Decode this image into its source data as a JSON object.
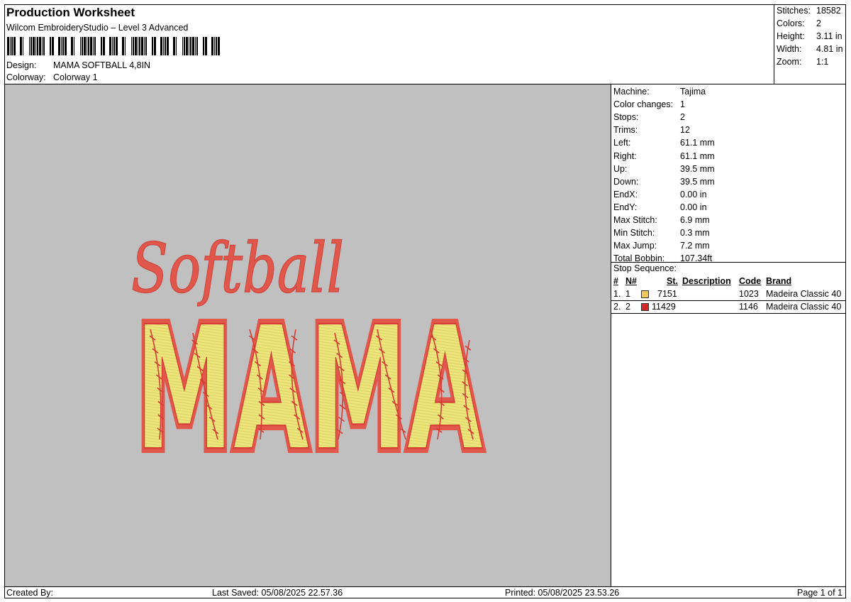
{
  "header": {
    "title": "Production Worksheet",
    "software": "Wilcom EmbroideryStudio – Level 3 Advanced",
    "design_label": "Design:",
    "design_value": "MAMA SOFTBALL 4,8IN",
    "colorway_label": "Colorway:",
    "colorway_value": "Colorway 1"
  },
  "stats": [
    {
      "label": "Stitches:",
      "value": "18582"
    },
    {
      "label": "Colors:",
      "value": "2"
    },
    {
      "label": "Height:",
      "value": "3.11 in"
    },
    {
      "label": "Width:",
      "value": "4.81 in"
    },
    {
      "label": "Zoom:",
      "value": "1:1"
    }
  ],
  "design_preview": {
    "script_text": "Softball",
    "block_text": "MAMA",
    "colors": {
      "background": "#c0c0c0",
      "outline_red": "#e2574c",
      "fill_yellow": "#ece57c",
      "seam_red": "#d43c34"
    }
  },
  "machine_info": [
    {
      "label": "Machine:",
      "value": "Tajima"
    },
    {
      "label": "Color changes:",
      "value": "1"
    },
    {
      "label": "Stops:",
      "value": "2"
    },
    {
      "label": "Trims:",
      "value": "12"
    },
    {
      "label": "Left:",
      "value": "61.1 mm"
    },
    {
      "label": "Right:",
      "value": "61.1 mm"
    },
    {
      "label": "Up:",
      "value": "39.5 mm"
    },
    {
      "label": "Down:",
      "value": "39.5 mm"
    },
    {
      "label": "EndX:",
      "value": "0.00 in"
    },
    {
      "label": "EndY:",
      "value": "0.00 in"
    },
    {
      "label": "Max Stitch:",
      "value": "6.9 mm"
    },
    {
      "label": "Min Stitch:",
      "value": "0.3 mm"
    },
    {
      "label": "Max Jump:",
      "value": "7.2 mm"
    },
    {
      "label": "Total Bobbin:",
      "value": "107.34ft"
    }
  ],
  "stop_sequence": {
    "label": "Stop Sequence:",
    "headers": {
      "num": "#",
      "n": "N#",
      "st": "St.",
      "description": "Description",
      "code": "Code",
      "brand": "Brand"
    },
    "rows": [
      {
        "num": "1.",
        "n": "1",
        "color": "#f2c75c",
        "st": "7151",
        "description": "",
        "code": "1023",
        "brand": "Madeira Classic 40"
      },
      {
        "num": "2.",
        "n": "2",
        "color": "#d42828",
        "st": "11429",
        "description": "",
        "code": "1146",
        "brand": "Madeira Classic 40"
      }
    ]
  },
  "footer": {
    "created_by": "Created By:",
    "last_saved": "Last Saved: 05/08/2025 22.57.36",
    "printed": "Printed: 05/08/2025 23.53.26",
    "page": "Page 1 of 1"
  }
}
